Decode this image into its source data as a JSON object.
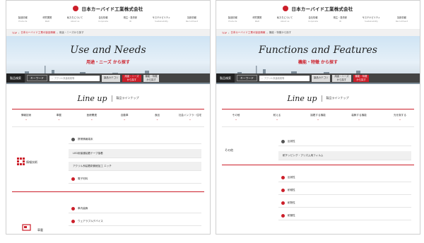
{
  "company": "日本カーバイド工業株式会社",
  "nav_items": [
    {
      "label": "製品情報",
      "sub": "Products"
    },
    {
      "label": "研究開発",
      "sub": "R&D"
    },
    {
      "label": "私たちについて",
      "sub": "About us"
    },
    {
      "label": "会社情報",
      "sub": "Corporate"
    },
    {
      "label": "株主・投資家",
      "sub": "IR"
    },
    {
      "label": "サステナビリティ",
      "sub": "Sustainability"
    },
    {
      "label": "採用情報",
      "sub": "Recruitment"
    }
  ],
  "left": {
    "crumbs": [
      "TOP",
      "日本カーバイド工業の製品情報",
      "用途・ニーズから探す"
    ],
    "hero_title": "Use and Needs",
    "hero_sub": "用途・ニーズ から探す",
    "search": {
      "label": "製品検索",
      "keyword_tab": "キーワード",
      "placeholder": "アクリル系接着剤等",
      "btn_category": "製品カテゴリ",
      "btn_use": "用途・ニーズ",
      "btn_use_sub": "から探す",
      "btn_func": "機能・特徴",
      "btn_func_sub": "から探す"
    },
    "lineup_title": "Line up",
    "lineup_sub": "製品ラインナップ",
    "categories": [
      "情報技術",
      "車載",
      "医療関連",
      "自動車",
      "食品",
      "社会インフラ・住宅"
    ],
    "section1": "情報技術",
    "rows1": [
      {
        "text": "携帯情報端末",
        "grey": false
      },
      {
        "text": "LED用保護粘着テープ接着",
        "grey": true
      },
      {
        "text": "アクリル系粘着剤微細加工 エッチ",
        "grey": true
      },
      {
        "text": "電子材料",
        "grey": false
      }
    ],
    "section2": "車載",
    "rows2": [
      {
        "text": "車内装飾",
        "grey": false
      },
      {
        "text": "ウェアラブルデバイス",
        "grey": false
      }
    ]
  },
  "right": {
    "crumbs": [
      "TOP",
      "日本カーバイド工業の製品情報",
      "機能・特徴から探す"
    ],
    "hero_title": "Functions and Features",
    "hero_sub": "機能・特徴 から探す",
    "search": {
      "label": "製品検索",
      "keyword_tab": "キーワード",
      "placeholder": "アクリル系接着剤等",
      "btn_category": "製品カテゴリ",
      "btn_use": "用途・ニーズ",
      "btn_use_sub": "から探す",
      "btn_func": "機能・特徴",
      "btn_func_sub": "から探す"
    },
    "lineup_title": "Line up",
    "lineup_sub": "製品ラインナップ",
    "categories": [
      "その他",
      "耐える",
      "接着する機能",
      "装飾する機能",
      "光を制する"
    ],
    "section1": "その他",
    "rows1": [
      {
        "text": "反射性",
        "grey": false
      },
      {
        "text": "耐チッピング・プリズム用フィルム",
        "grey": true
      },
      {
        "text": "反射性",
        "grey": false
      },
      {
        "text": "耐候性",
        "grey": false
      },
      {
        "text": "耐熱性",
        "grey": false
      },
      {
        "text": "耐薬性",
        "grey": false
      }
    ]
  },
  "colors": {
    "accent": "#cc1f2a",
    "dark": "#333333"
  }
}
